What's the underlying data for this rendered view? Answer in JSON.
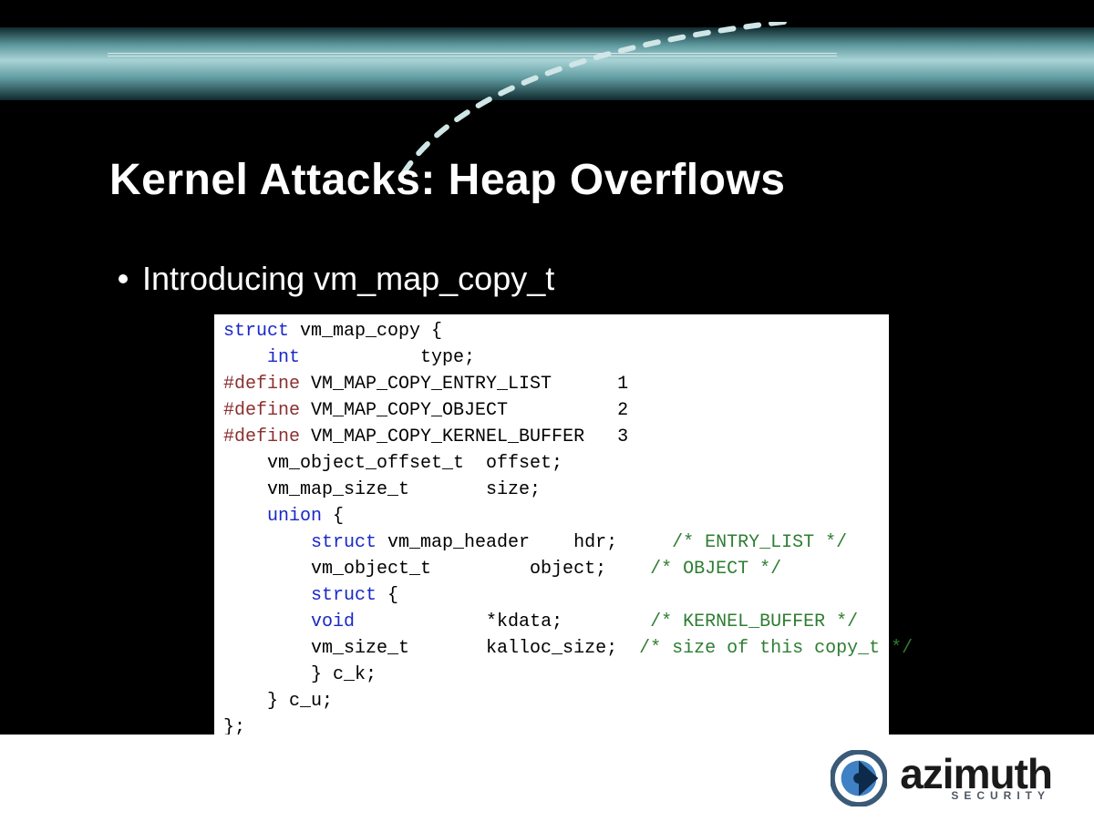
{
  "title": "Kernel Attacks: Heap Overflows",
  "bullet": "Introducing vm_map_copy_t",
  "code": {
    "l01_a": "struct",
    "l01_b": " vm_map_copy {",
    "l02_a": "    ",
    "l02_b": "int",
    "l02_c": "           type;",
    "l03_a": "#define",
    "l03_b": " VM_MAP_COPY_ENTRY_LIST      1",
    "l04_a": "#define",
    "l04_b": " VM_MAP_COPY_OBJECT          2",
    "l05_a": "#define",
    "l05_b": " VM_MAP_COPY_KERNEL_BUFFER   3",
    "l06": "    vm_object_offset_t  offset;",
    "l07": "    vm_map_size_t       size;",
    "l08_a": "    ",
    "l08_b": "union",
    "l08_c": " {",
    "l09_a": "        ",
    "l09_b": "struct",
    "l09_c": " vm_map_header    hdr;     ",
    "l09_d": "/* ENTRY_LIST */",
    "l10_a": "        vm_object_t         object;    ",
    "l10_b": "/* OBJECT */",
    "l11_a": "        ",
    "l11_b": "struct",
    "l11_c": " {",
    "l12_a": "        ",
    "l12_b": "void",
    "l12_c": "            *kdata;        ",
    "l12_d": "/* KERNEL_BUFFER */",
    "l13_a": "        vm_size_t       kalloc_size;  ",
    "l13_b": "/* size of this copy_t */",
    "l14": "        } c_k;",
    "l15": "    } c_u;",
    "l16": "};"
  },
  "brand": {
    "name": "azimuth",
    "sub": "SECURITY"
  }
}
